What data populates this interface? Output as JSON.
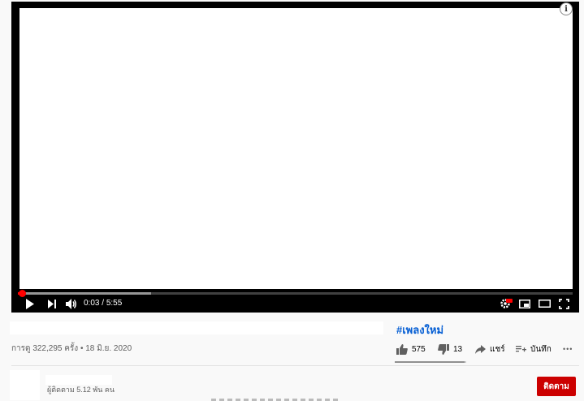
{
  "player": {
    "current_time": "0:03",
    "separator": "/",
    "duration": "5:55",
    "played_fraction": 0.008,
    "buffered_fraction": 0.24,
    "info_icon_label": "i",
    "colors": {
      "progress": "#ff0000",
      "background": "#000000"
    }
  },
  "video": {
    "title": "#เพลงใหม่",
    "views_date": "การดู 322,295 ครั้ง • 18 มิ.ย. 2020",
    "like_count": "575",
    "dislike_count": "13",
    "share_label": "แชร์",
    "save_label": "บันทึก",
    "more_label": "•••",
    "like_ratio": 0.978
  },
  "channel": {
    "subscribers": "ผู้ติดตาม 5.12 พัน คน",
    "subscribe_label": "ติดตาม",
    "colors": {
      "subscribe": "#cc0000"
    }
  }
}
